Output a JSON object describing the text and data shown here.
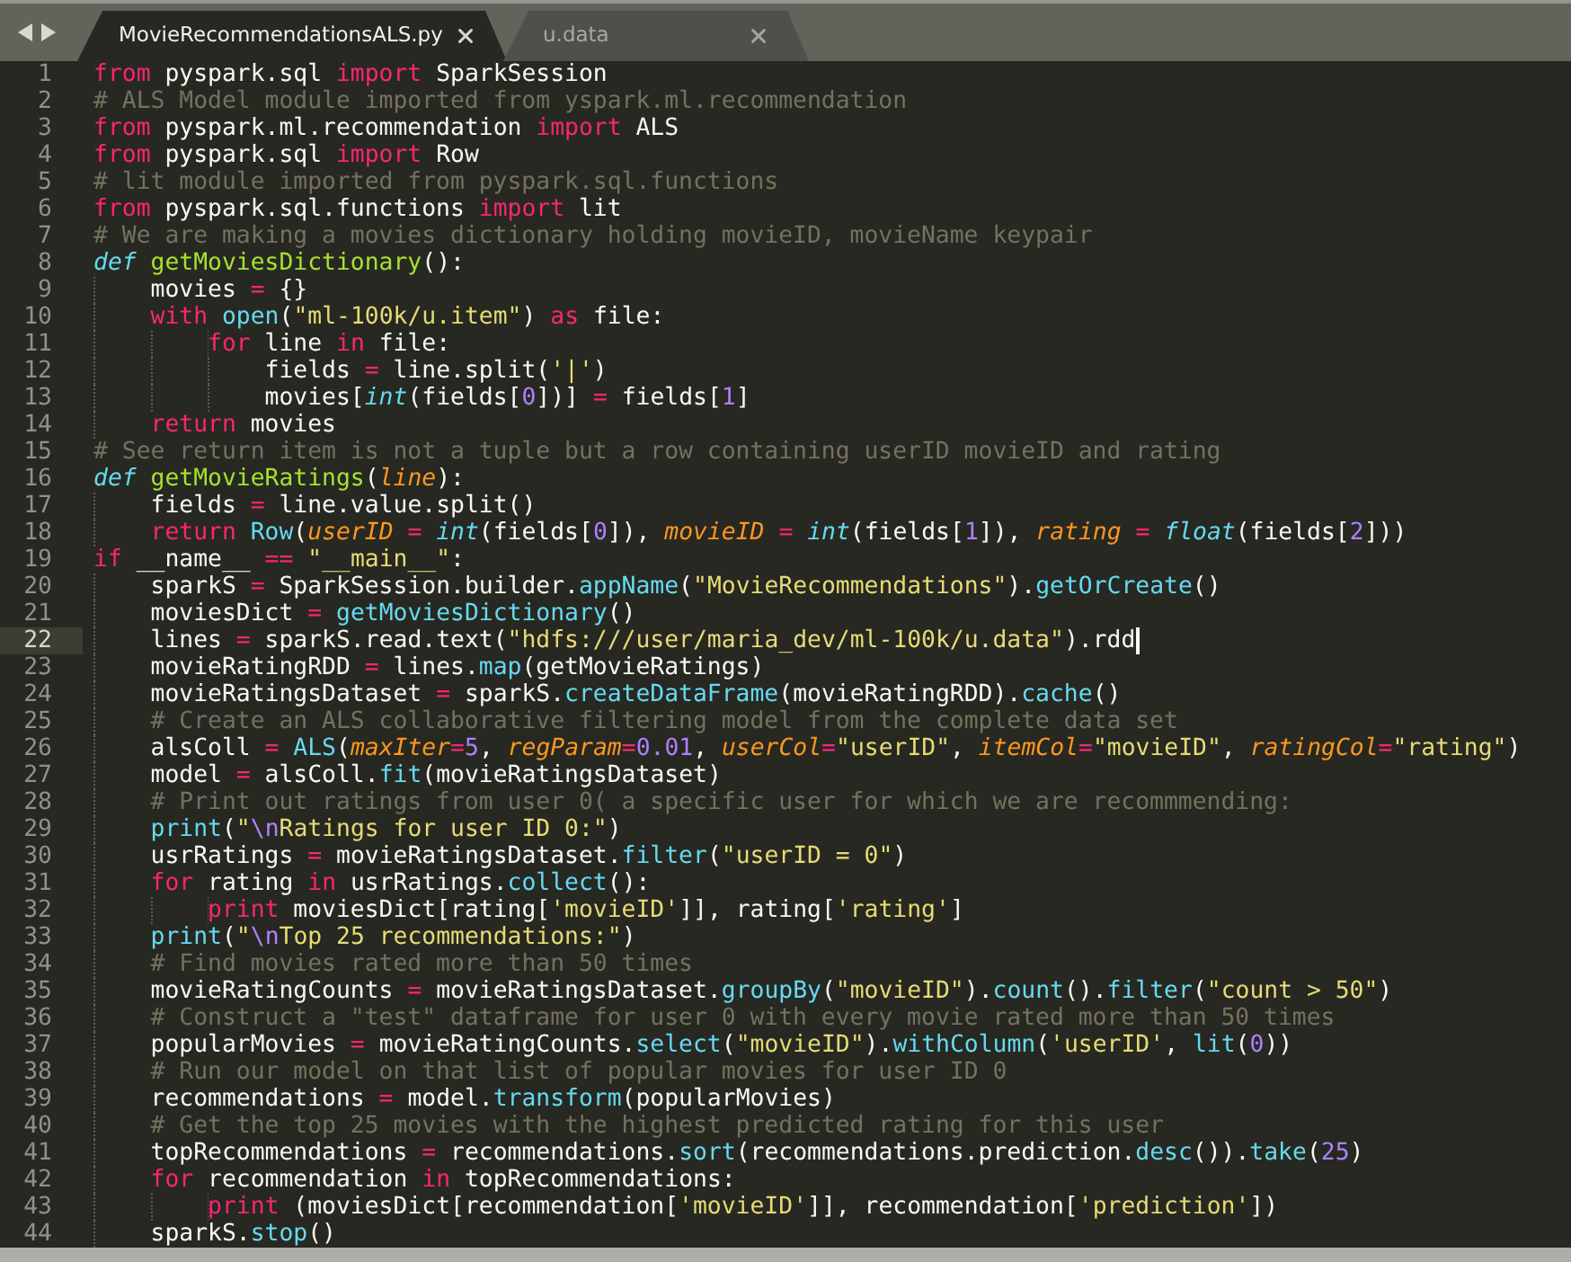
{
  "tabs": [
    {
      "label": "MovieRecommendationsALS.py",
      "selected": true
    },
    {
      "label": "u.data",
      "selected": false
    }
  ],
  "lines": [
    {
      "number": "1",
      "current": false,
      "tokens": [
        {
          "kind": "keyword",
          "text": "from"
        },
        {
          "kind": "plain",
          "text": " pyspark.sql "
        },
        {
          "kind": "keyword",
          "text": "import"
        },
        {
          "kind": "plain",
          "text": " SparkSession"
        }
      ]
    },
    {
      "number": "2",
      "current": false,
      "tokens": [
        {
          "kind": "comment",
          "text": "# ALS Model module imported from yspark.ml.recommendation"
        }
      ]
    },
    {
      "number": "3",
      "current": false,
      "tokens": [
        {
          "kind": "keyword",
          "text": "from"
        },
        {
          "kind": "plain",
          "text": " pyspark.ml.recommendation "
        },
        {
          "kind": "keyword",
          "text": "import"
        },
        {
          "kind": "plain",
          "text": " ALS"
        }
      ]
    },
    {
      "number": "4",
      "current": false,
      "tokens": [
        {
          "kind": "keyword",
          "text": "from"
        },
        {
          "kind": "plain",
          "text": " pyspark.sql "
        },
        {
          "kind": "keyword",
          "text": "import"
        },
        {
          "kind": "plain",
          "text": " Row"
        }
      ]
    },
    {
      "number": "5",
      "current": false,
      "tokens": [
        {
          "kind": "comment",
          "text": "# lit module imported from pyspark.sql.functions"
        }
      ]
    },
    {
      "number": "6",
      "current": false,
      "tokens": [
        {
          "kind": "keyword",
          "text": "from"
        },
        {
          "kind": "plain",
          "text": " pyspark.sql.functions "
        },
        {
          "kind": "keyword",
          "text": "import"
        },
        {
          "kind": "plain",
          "text": " lit"
        }
      ]
    },
    {
      "number": "7",
      "current": false,
      "tokens": [
        {
          "kind": "comment",
          "text": "# We are making a movies dictionary holding movieID, movieName keypair"
        }
      ]
    },
    {
      "number": "8",
      "current": false,
      "tokens": [
        {
          "kind": "storage",
          "text": "def "
        },
        {
          "kind": "def-name",
          "text": "getMoviesDictionary"
        },
        {
          "kind": "plain",
          "text": "():"
        }
      ]
    },
    {
      "number": "9",
      "current": false,
      "tokens": [
        {
          "kind": "plain",
          "text": "    movies"
        },
        {
          "kind": "keyword",
          "text": " = "
        },
        {
          "kind": "plain",
          "text": "{}"
        }
      ]
    },
    {
      "number": "10",
      "current": false,
      "tokens": [
        {
          "kind": "keyword",
          "text": "    with "
        },
        {
          "kind": "call",
          "text": "open"
        },
        {
          "kind": "plain",
          "text": "("
        },
        {
          "kind": "string",
          "text": "\"ml-100k/u.item\""
        },
        {
          "kind": "plain",
          "text": ") "
        },
        {
          "kind": "keyword",
          "text": "as"
        },
        {
          "kind": "plain",
          "text": " file:"
        }
      ]
    },
    {
      "number": "11",
      "current": false,
      "tokens": [
        {
          "kind": "keyword",
          "text": "        for"
        },
        {
          "kind": "plain",
          "text": " line "
        },
        {
          "kind": "keyword",
          "text": "in"
        },
        {
          "kind": "plain",
          "text": " file:"
        }
      ]
    },
    {
      "number": "12",
      "current": false,
      "tokens": [
        {
          "kind": "plain",
          "text": "            fields"
        },
        {
          "kind": "keyword",
          "text": " = "
        },
        {
          "kind": "plain",
          "text": "line.split("
        },
        {
          "kind": "string",
          "text": "'|'"
        },
        {
          "kind": "plain",
          "text": ")"
        }
      ]
    },
    {
      "number": "13",
      "current": false,
      "tokens": [
        {
          "kind": "plain",
          "text": "            movies["
        },
        {
          "kind": "builtin",
          "text": "int"
        },
        {
          "kind": "plain",
          "text": "(fields["
        },
        {
          "kind": "number",
          "text": "0"
        },
        {
          "kind": "plain",
          "text": "])]"
        },
        {
          "kind": "keyword",
          "text": " = "
        },
        {
          "kind": "plain",
          "text": "fields["
        },
        {
          "kind": "number",
          "text": "1"
        },
        {
          "kind": "plain",
          "text": "]"
        }
      ]
    },
    {
      "number": "14",
      "current": false,
      "tokens": [
        {
          "kind": "keyword",
          "text": "    return"
        },
        {
          "kind": "plain",
          "text": " movies"
        }
      ]
    },
    {
      "number": "15",
      "current": false,
      "tokens": [
        {
          "kind": "comment",
          "text": "# See return item is not a tuple but a row containing userID movieID and rating"
        }
      ]
    },
    {
      "number": "16",
      "current": false,
      "tokens": [
        {
          "kind": "storage",
          "text": "def "
        },
        {
          "kind": "def-name",
          "text": "getMovieRatings"
        },
        {
          "kind": "plain",
          "text": "("
        },
        {
          "kind": "param",
          "text": "line"
        },
        {
          "kind": "plain",
          "text": "):"
        }
      ]
    },
    {
      "number": "17",
      "current": false,
      "tokens": [
        {
          "kind": "plain",
          "text": "    fields"
        },
        {
          "kind": "keyword",
          "text": " = "
        },
        {
          "kind": "plain",
          "text": "line.value.split()"
        }
      ]
    },
    {
      "number": "18",
      "current": false,
      "tokens": [
        {
          "kind": "keyword",
          "text": "    return "
        },
        {
          "kind": "call",
          "text": "Row"
        },
        {
          "kind": "plain",
          "text": "("
        },
        {
          "kind": "param",
          "text": "userID"
        },
        {
          "kind": "keyword",
          "text": " = "
        },
        {
          "kind": "builtin",
          "text": "int"
        },
        {
          "kind": "plain",
          "text": "(fields["
        },
        {
          "kind": "number",
          "text": "0"
        },
        {
          "kind": "plain",
          "text": "]), "
        },
        {
          "kind": "param",
          "text": "movieID"
        },
        {
          "kind": "keyword",
          "text": " = "
        },
        {
          "kind": "builtin",
          "text": "int"
        },
        {
          "kind": "plain",
          "text": "(fields["
        },
        {
          "kind": "number",
          "text": "1"
        },
        {
          "kind": "plain",
          "text": "]), "
        },
        {
          "kind": "param",
          "text": "rating"
        },
        {
          "kind": "keyword",
          "text": " = "
        },
        {
          "kind": "builtin",
          "text": "float"
        },
        {
          "kind": "plain",
          "text": "(fields["
        },
        {
          "kind": "number",
          "text": "2"
        },
        {
          "kind": "plain",
          "text": "]))"
        }
      ]
    },
    {
      "number": "19",
      "current": false,
      "tokens": [
        {
          "kind": "keyword",
          "text": "if"
        },
        {
          "kind": "plain",
          "text": " __name__ "
        },
        {
          "kind": "keyword",
          "text": "== "
        },
        {
          "kind": "string",
          "text": "\"__main__\""
        },
        {
          "kind": "plain",
          "text": ":"
        }
      ]
    },
    {
      "number": "20",
      "current": false,
      "tokens": [
        {
          "kind": "plain",
          "text": "    sparkS"
        },
        {
          "kind": "keyword",
          "text": " = "
        },
        {
          "kind": "plain",
          "text": "SparkSession.builder."
        },
        {
          "kind": "call",
          "text": "appName"
        },
        {
          "kind": "plain",
          "text": "("
        },
        {
          "kind": "string",
          "text": "\"MovieRecommendations\""
        },
        {
          "kind": "plain",
          "text": ")."
        },
        {
          "kind": "call",
          "text": "getOrCreate"
        },
        {
          "kind": "plain",
          "text": "()"
        }
      ]
    },
    {
      "number": "21",
      "current": false,
      "tokens": [
        {
          "kind": "plain",
          "text": "    moviesDict"
        },
        {
          "kind": "keyword",
          "text": " = "
        },
        {
          "kind": "call",
          "text": "getMoviesDictionary"
        },
        {
          "kind": "plain",
          "text": "()"
        }
      ]
    },
    {
      "number": "22",
      "current": true,
      "tokens": [
        {
          "kind": "plain",
          "text": "    lines"
        },
        {
          "kind": "keyword",
          "text": " = "
        },
        {
          "kind": "plain",
          "text": "sparkS.read.text("
        },
        {
          "kind": "string",
          "text": "\"hdfs:///user/maria_dev/ml-100k/u.data\""
        },
        {
          "kind": "plain",
          "text": ").rdd"
        }
      ]
    },
    {
      "number": "23",
      "current": false,
      "tokens": [
        {
          "kind": "plain",
          "text": "    movieRatingRDD"
        },
        {
          "kind": "keyword",
          "text": " = "
        },
        {
          "kind": "plain",
          "text": "lines."
        },
        {
          "kind": "call",
          "text": "map"
        },
        {
          "kind": "plain",
          "text": "(getMovieRatings)"
        }
      ]
    },
    {
      "number": "24",
      "current": false,
      "tokens": [
        {
          "kind": "plain",
          "text": "    movieRatingsDataset"
        },
        {
          "kind": "keyword",
          "text": " = "
        },
        {
          "kind": "plain",
          "text": "sparkS."
        },
        {
          "kind": "call",
          "text": "createDataFrame"
        },
        {
          "kind": "plain",
          "text": "(movieRatingRDD)."
        },
        {
          "kind": "call",
          "text": "cache"
        },
        {
          "kind": "plain",
          "text": "()"
        }
      ]
    },
    {
      "number": "25",
      "current": false,
      "tokens": [
        {
          "kind": "comment",
          "text": "    # Create an ALS collaborative filtering model from the complete data set"
        }
      ]
    },
    {
      "number": "26",
      "current": false,
      "tokens": [
        {
          "kind": "plain",
          "text": "    alsColl"
        },
        {
          "kind": "keyword",
          "text": " = "
        },
        {
          "kind": "call",
          "text": "ALS"
        },
        {
          "kind": "plain",
          "text": "("
        },
        {
          "kind": "param",
          "text": "maxIter"
        },
        {
          "kind": "keyword",
          "text": "="
        },
        {
          "kind": "number",
          "text": "5"
        },
        {
          "kind": "plain",
          "text": ", "
        },
        {
          "kind": "param",
          "text": "regParam"
        },
        {
          "kind": "keyword",
          "text": "="
        },
        {
          "kind": "number",
          "text": "0.01"
        },
        {
          "kind": "plain",
          "text": ", "
        },
        {
          "kind": "param",
          "text": "userCol"
        },
        {
          "kind": "keyword",
          "text": "="
        },
        {
          "kind": "string",
          "text": "\"userID\""
        },
        {
          "kind": "plain",
          "text": ", "
        },
        {
          "kind": "param",
          "text": "itemCol"
        },
        {
          "kind": "keyword",
          "text": "="
        },
        {
          "kind": "string",
          "text": "\"movieID\""
        },
        {
          "kind": "plain",
          "text": ", "
        },
        {
          "kind": "param",
          "text": "ratingCol"
        },
        {
          "kind": "keyword",
          "text": "="
        },
        {
          "kind": "string",
          "text": "\"rating\""
        },
        {
          "kind": "plain",
          "text": ")"
        }
      ]
    },
    {
      "number": "27",
      "current": false,
      "tokens": [
        {
          "kind": "plain",
          "text": "    model"
        },
        {
          "kind": "keyword",
          "text": " = "
        },
        {
          "kind": "plain",
          "text": "alsColl."
        },
        {
          "kind": "call",
          "text": "fit"
        },
        {
          "kind": "plain",
          "text": "(movieRatingsDataset)"
        }
      ]
    },
    {
      "number": "28",
      "current": false,
      "tokens": [
        {
          "kind": "comment",
          "text": "    # Print out ratings from user 0( a specific user for which we are recommmending:"
        }
      ]
    },
    {
      "number": "29",
      "current": false,
      "tokens": [
        {
          "kind": "call",
          "text": "    print"
        },
        {
          "kind": "plain",
          "text": "("
        },
        {
          "kind": "string",
          "text": "\""
        },
        {
          "kind": "escape",
          "text": "\\n"
        },
        {
          "kind": "string",
          "text": "Ratings for user ID 0:\""
        },
        {
          "kind": "plain",
          "text": ")"
        }
      ]
    },
    {
      "number": "30",
      "current": false,
      "tokens": [
        {
          "kind": "plain",
          "text": "    usrRatings"
        },
        {
          "kind": "keyword",
          "text": " = "
        },
        {
          "kind": "plain",
          "text": "movieRatingsDataset."
        },
        {
          "kind": "call",
          "text": "filter"
        },
        {
          "kind": "plain",
          "text": "("
        },
        {
          "kind": "string",
          "text": "\"userID = 0\""
        },
        {
          "kind": "plain",
          "text": ")"
        }
      ]
    },
    {
      "number": "31",
      "current": false,
      "tokens": [
        {
          "kind": "keyword",
          "text": "    for"
        },
        {
          "kind": "plain",
          "text": " rating "
        },
        {
          "kind": "keyword",
          "text": "in"
        },
        {
          "kind": "plain",
          "text": " usrRatings."
        },
        {
          "kind": "call",
          "text": "collect"
        },
        {
          "kind": "plain",
          "text": "():"
        }
      ]
    },
    {
      "number": "32",
      "current": false,
      "tokens": [
        {
          "kind": "keyword",
          "text": "        print"
        },
        {
          "kind": "plain",
          "text": " moviesDict[rating["
        },
        {
          "kind": "string",
          "text": "'movieID'"
        },
        {
          "kind": "plain",
          "text": "]], rating["
        },
        {
          "kind": "string",
          "text": "'rating'"
        },
        {
          "kind": "plain",
          "text": "]"
        }
      ]
    },
    {
      "number": "33",
      "current": false,
      "tokens": [
        {
          "kind": "call",
          "text": "    print"
        },
        {
          "kind": "plain",
          "text": "("
        },
        {
          "kind": "string",
          "text": "\""
        },
        {
          "kind": "escape",
          "text": "\\n"
        },
        {
          "kind": "string",
          "text": "Top 25 recommendations:\""
        },
        {
          "kind": "plain",
          "text": ")"
        }
      ]
    },
    {
      "number": "34",
      "current": false,
      "tokens": [
        {
          "kind": "comment",
          "text": "    # Find movies rated more than 50 times"
        }
      ]
    },
    {
      "number": "35",
      "current": false,
      "tokens": [
        {
          "kind": "plain",
          "text": "    movieRatingCounts"
        },
        {
          "kind": "keyword",
          "text": " = "
        },
        {
          "kind": "plain",
          "text": "movieRatingsDataset."
        },
        {
          "kind": "call",
          "text": "groupBy"
        },
        {
          "kind": "plain",
          "text": "("
        },
        {
          "kind": "string",
          "text": "\"movieID\""
        },
        {
          "kind": "plain",
          "text": ")."
        },
        {
          "kind": "call",
          "text": "count"
        },
        {
          "kind": "plain",
          "text": "()."
        },
        {
          "kind": "call",
          "text": "filter"
        },
        {
          "kind": "plain",
          "text": "("
        },
        {
          "kind": "string",
          "text": "\"count > 50\""
        },
        {
          "kind": "plain",
          "text": ")"
        }
      ]
    },
    {
      "number": "36",
      "current": false,
      "tokens": [
        {
          "kind": "comment",
          "text": "    # Construct a \"test\" dataframe for user 0 with every movie rated more than 50 times"
        }
      ]
    },
    {
      "number": "37",
      "current": false,
      "tokens": [
        {
          "kind": "plain",
          "text": "    popularMovies"
        },
        {
          "kind": "keyword",
          "text": " = "
        },
        {
          "kind": "plain",
          "text": "movieRatingCounts."
        },
        {
          "kind": "call",
          "text": "select"
        },
        {
          "kind": "plain",
          "text": "("
        },
        {
          "kind": "string",
          "text": "\"movieID\""
        },
        {
          "kind": "plain",
          "text": ")."
        },
        {
          "kind": "call",
          "text": "withColumn"
        },
        {
          "kind": "plain",
          "text": "("
        },
        {
          "kind": "string",
          "text": "'userID'"
        },
        {
          "kind": "plain",
          "text": ", "
        },
        {
          "kind": "call",
          "text": "lit"
        },
        {
          "kind": "plain",
          "text": "("
        },
        {
          "kind": "number",
          "text": "0"
        },
        {
          "kind": "plain",
          "text": "))"
        }
      ]
    },
    {
      "number": "38",
      "current": false,
      "tokens": [
        {
          "kind": "comment",
          "text": "    # Run our model on that list of popular movies for user ID 0"
        }
      ]
    },
    {
      "number": "39",
      "current": false,
      "tokens": [
        {
          "kind": "plain",
          "text": "    recommendations"
        },
        {
          "kind": "keyword",
          "text": " = "
        },
        {
          "kind": "plain",
          "text": "model."
        },
        {
          "kind": "call",
          "text": "transform"
        },
        {
          "kind": "plain",
          "text": "(popularMovies)"
        }
      ]
    },
    {
      "number": "40",
      "current": false,
      "tokens": [
        {
          "kind": "comment",
          "text": "    # Get the top 25 movies with the highest predicted rating for this user"
        }
      ]
    },
    {
      "number": "41",
      "current": false,
      "tokens": [
        {
          "kind": "plain",
          "text": "    topRecommendations"
        },
        {
          "kind": "keyword",
          "text": " = "
        },
        {
          "kind": "plain",
          "text": "recommendations."
        },
        {
          "kind": "call",
          "text": "sort"
        },
        {
          "kind": "plain",
          "text": "(recommendations.prediction."
        },
        {
          "kind": "call",
          "text": "desc"
        },
        {
          "kind": "plain",
          "text": "())."
        },
        {
          "kind": "call",
          "text": "take"
        },
        {
          "kind": "plain",
          "text": "("
        },
        {
          "kind": "number",
          "text": "25"
        },
        {
          "kind": "plain",
          "text": ")"
        }
      ]
    },
    {
      "number": "42",
      "current": false,
      "tokens": [
        {
          "kind": "keyword",
          "text": "    for"
        },
        {
          "kind": "plain",
          "text": " recommendation "
        },
        {
          "kind": "keyword",
          "text": "in"
        },
        {
          "kind": "plain",
          "text": " topRecommendations:"
        }
      ]
    },
    {
      "number": "43",
      "current": false,
      "tokens": [
        {
          "kind": "keyword",
          "text": "        print"
        },
        {
          "kind": "plain",
          "text": " (moviesDict[recommendation["
        },
        {
          "kind": "string",
          "text": "'movieID'"
        },
        {
          "kind": "plain",
          "text": "]], recommendation["
        },
        {
          "kind": "string",
          "text": "'prediction'"
        },
        {
          "kind": "plain",
          "text": "])"
        }
      ]
    },
    {
      "number": "44",
      "current": false,
      "tokens": [
        {
          "kind": "plain",
          "text": "    sparkS."
        },
        {
          "kind": "call",
          "text": "stop"
        },
        {
          "kind": "plain",
          "text": "()"
        }
      ]
    }
  ]
}
